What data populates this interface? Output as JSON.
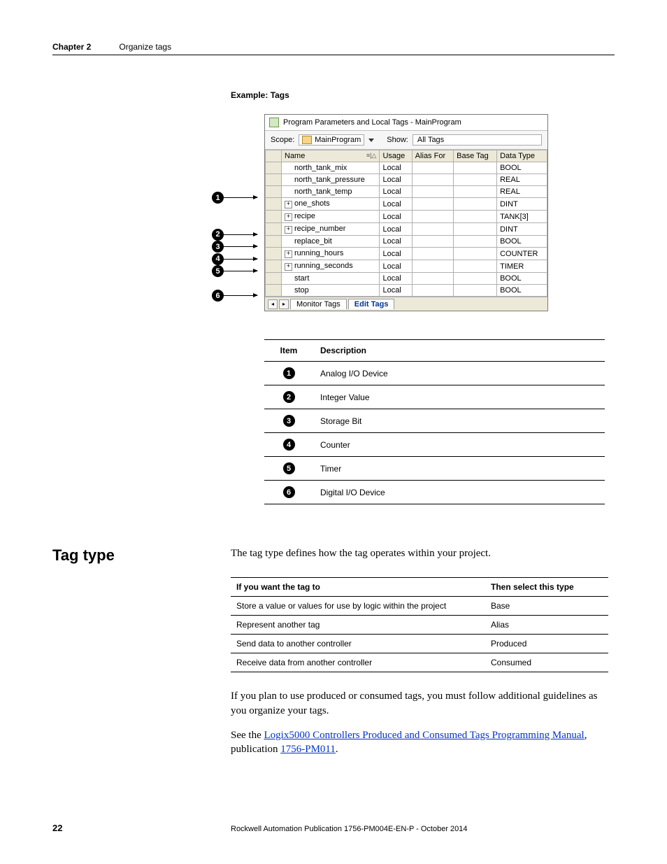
{
  "header": {
    "chapter_label": "Chapter 2",
    "chapter_title": "Organize tags"
  },
  "example_label": "Example:   Tags",
  "screenshot": {
    "title": "Program Parameters and Local Tags - MainProgram",
    "scope_label": "Scope:",
    "scope_value": "MainProgram",
    "show_label": "Show:",
    "show_value": "All Tags",
    "columns": {
      "name": "Name",
      "usage": "Usage",
      "alias_for": "Alias For",
      "base_tag": "Base Tag",
      "data_type": "Data Type"
    },
    "rows": [
      {
        "name": "north_tank_mix",
        "usage": "Local",
        "type": "BOOL",
        "expand": false,
        "indent": true
      },
      {
        "name": "north_tank_pressure",
        "usage": "Local",
        "type": "REAL",
        "expand": false,
        "indent": true
      },
      {
        "name": "north_tank_temp",
        "usage": "Local",
        "type": "REAL",
        "expand": false,
        "indent": true
      },
      {
        "name": "one_shots",
        "usage": "Local",
        "type": "DINT",
        "expand": true,
        "indent": false
      },
      {
        "name": "recipe",
        "usage": "Local",
        "type": "TANK[3]",
        "expand": true,
        "indent": false
      },
      {
        "name": "recipe_number",
        "usage": "Local",
        "type": "DINT",
        "expand": true,
        "indent": false
      },
      {
        "name": "replace_bit",
        "usage": "Local",
        "type": "BOOL",
        "expand": false,
        "indent": true
      },
      {
        "name": "running_hours",
        "usage": "Local",
        "type": "COUNTER",
        "expand": true,
        "indent": false
      },
      {
        "name": "running_seconds",
        "usage": "Local",
        "type": "TIMER",
        "expand": true,
        "indent": false
      },
      {
        "name": "start",
        "usage": "Local",
        "type": "BOOL",
        "expand": false,
        "indent": true
      },
      {
        "name": "stop",
        "usage": "Local",
        "type": "BOOL",
        "expand": false,
        "indent": true
      }
    ],
    "tab_monitor": "Monitor Tags",
    "tab_edit": "Edit Tags"
  },
  "callouts": [
    {
      "num": "1",
      "row": 2
    },
    {
      "num": "2",
      "row": 5
    },
    {
      "num": "3",
      "row": 6
    },
    {
      "num": "4",
      "row": 7
    },
    {
      "num": "5",
      "row": 8
    },
    {
      "num": "6",
      "row": 10
    }
  ],
  "desc_table": {
    "head_item": "Item",
    "head_desc": "Description",
    "rows": [
      {
        "num": "1",
        "desc": "Analog I/O Device"
      },
      {
        "num": "2",
        "desc": "Integer Value"
      },
      {
        "num": "3",
        "desc": "Storage Bit"
      },
      {
        "num": "4",
        "desc": "Counter"
      },
      {
        "num": "5",
        "desc": "Timer"
      },
      {
        "num": "6",
        "desc": "Digital I/O Device"
      }
    ]
  },
  "tag_type": {
    "heading": "Tag type",
    "intro": "The tag type defines how the tag operates within your project.",
    "th1": "If you want the tag to",
    "th2": "Then select this type",
    "rows": [
      {
        "c1": "Store a value or values for use by logic within the project",
        "c2": "Base"
      },
      {
        "c1": "Represent another tag",
        "c2": "Alias"
      },
      {
        "c1": "Send data to another controller",
        "c2": "Produced"
      },
      {
        "c1": "Receive data from another controller",
        "c2": "Consumed"
      }
    ],
    "para1": "If you plan to use produced or consumed tags, you must follow additional guidelines as you organize your tags.",
    "see_prefix": "See the ",
    "link1": "Logix5000 Controllers Produced and Consumed Tags Programming Manual",
    "mid": ", publication ",
    "link2": "1756-PM011",
    "suffix": "."
  },
  "footer": {
    "page": "22",
    "pub": "Rockwell Automation Publication 1756-PM004E-EN-P - October 2014"
  }
}
